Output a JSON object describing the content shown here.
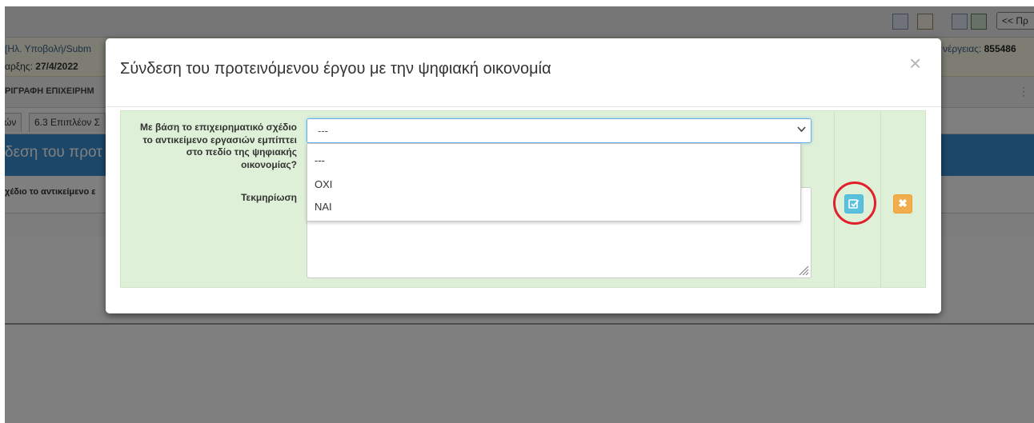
{
  "background": {
    "toolbar": {
      "nav_button_label": "<< Πρ"
    },
    "info": {
      "submission_text": "[Ηλ. Υποβολή/Subm",
      "date_label": "αρξης:",
      "date_value": "27/4/2022",
      "code_label": "νέργειας:",
      "code_value": "855486"
    },
    "section_title": "ΡΙΓΡΑΦΗ ΕΠΙΧΕΙΡΗΜ",
    "tabs": [
      "ών",
      "6.3 Επιπλέον Σ"
    ],
    "heading": "δεση του προτ",
    "question_fragment": "χέδιο το αντικείμενο ε"
  },
  "modal": {
    "title": "Σύνδεση του προτεινόμενου έργου με την ψηφιακή οικονομία",
    "close_symbol": "×",
    "question_label": "Με βάση το επιχειρηματικό σχέδιο το αντικείμενο εργασιών εμπίπτει στο πεδίο της ψηφιακής οικονομίας?",
    "documentation_label": "Τεκμηρίωση",
    "select": {
      "selected_value": "---",
      "options": [
        "---",
        "ΟΧΙ",
        "ΝΑΙ"
      ]
    },
    "textarea_value": "",
    "cancel_symbol": "✖"
  },
  "colors": {
    "save_button": "#5bc0de",
    "cancel_button": "#f0ad4e",
    "highlight_circle": "#e0202a",
    "form_background": "#dff0d8"
  }
}
